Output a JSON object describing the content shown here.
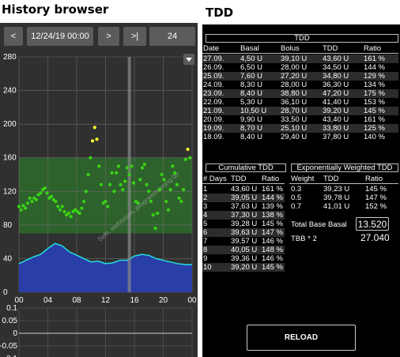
{
  "history": {
    "title": "History browser",
    "prev_label": "<",
    "date_value": "12/24/19 00:00",
    "next_label": ">",
    "end_label": ">|",
    "range_value": "24",
    "menu_icon": "dropdown-triangle-icon",
    "watermark": "Safe, rechtssym, programmierung 0h",
    "colors": {
      "background": "#303030",
      "target_band": "#2e6b2b",
      "bg_in_range": "#39d315",
      "bg_high": "#ffff33",
      "iob_fill": "#2a3ea8",
      "iob_line": "#23e0e0",
      "now_line": "#8a8a8a"
    }
  },
  "chart_data": [
    {
      "type": "scatter",
      "title": "",
      "xlabel": "",
      "ylabel": "",
      "xlim": [
        0,
        24
      ],
      "ylim": [
        0,
        280
      ],
      "x_ticks": [
        "00",
        "04",
        "08",
        "12",
        "16",
        "20",
        "00"
      ],
      "y_ticks": [
        "0",
        "40",
        "80",
        "120",
        "160",
        "200",
        "240",
        "280"
      ],
      "target_range": [
        70,
        160
      ],
      "now_marker_x": 15.3,
      "series": [
        {
          "kind": "points",
          "x": [
            0.0,
            0.3,
            0.6,
            0.9,
            1.2,
            1.5,
            1.8,
            2.1,
            2.4,
            2.7,
            3.0,
            3.3,
            3.6,
            3.9,
            4.2,
            4.5,
            4.8,
            5.1,
            5.4,
            5.7,
            6.0,
            6.3,
            6.6,
            6.9,
            7.2,
            7.5,
            7.8,
            8.1,
            8.4,
            8.7,
            9.0,
            9.3,
            9.6,
            9.9,
            10.2,
            10.5,
            10.8,
            11.1,
            11.4,
            11.7,
            12.0,
            12.3,
            12.6,
            12.9,
            13.2,
            13.5,
            13.8,
            14.1,
            14.4,
            14.7,
            15.0,
            15.3,
            15.6,
            15.9,
            16.2,
            16.5,
            16.8,
            17.1,
            17.4,
            17.7,
            18.0,
            18.3,
            18.6,
            18.9,
            19.2,
            19.5,
            19.8,
            20.1,
            20.4,
            20.7,
            21.0,
            21.3,
            21.6,
            21.9,
            22.2,
            22.5,
            22.8,
            23.1,
            23.4,
            23.7
          ],
          "y": [
            102,
            98,
            103,
            100,
            106,
            112,
            108,
            112,
            110,
            116,
            118,
            122,
            124,
            118,
            112,
            114,
            110,
            108,
            102,
            98,
            102,
            96,
            92,
            94,
            90,
            96,
            98,
            96,
            94,
            100,
            108,
            120,
            140,
            160,
            180,
            196,
            182,
            150,
            128,
            106,
            108,
            102,
            128,
            142,
            120,
            142,
            150,
            128,
            122,
            132,
            148,
            140,
            150,
            130,
            108,
            106,
            134,
            148,
            152,
            128,
            120,
            108,
            92,
            76,
            94,
            122,
            140,
            134,
            108,
            98,
            122,
            150,
            142,
            128,
            112,
            108,
            122,
            158,
            170,
            160
          ]
        },
        {
          "kind": "area",
          "x": [
            0,
            1,
            2,
            3,
            4,
            5,
            6,
            7,
            8,
            9,
            10,
            11,
            12,
            13,
            14,
            15,
            16,
            17,
            18,
            19,
            20,
            21,
            22,
            23,
            24
          ],
          "y": [
            34,
            38,
            42,
            45,
            52,
            58,
            55,
            48,
            44,
            40,
            36,
            37,
            34,
            35,
            38,
            38,
            43,
            45,
            44,
            40,
            38,
            36,
            34,
            33,
            33
          ]
        }
      ]
    },
    {
      "type": "line",
      "title": "",
      "ylim": [
        -0.1,
        0.1
      ],
      "y_ticks": [
        "0.1",
        "0.05",
        "0",
        "-0.05",
        "-0.1"
      ],
      "series": [
        {
          "kind": "flat",
          "y": 0
        }
      ]
    }
  ],
  "tdd": {
    "title": "TDD",
    "section_title": "TDD",
    "headers": [
      "Date",
      "Basal",
      "Bolus",
      "TDD",
      "Ratio"
    ],
    "rows": [
      [
        "27.09.",
        "4,50 U",
        "39,10 U",
        "43,60 U",
        "161 %"
      ],
      [
        "26.09.",
        "6,50 U",
        "28,00 U",
        "34,50 U",
        "144 %"
      ],
      [
        "25.09.",
        "7,60 U",
        "27,20 U",
        "34,80 U",
        "129 %"
      ],
      [
        "24.09.",
        "8,30 U",
        "28,00 U",
        "36,30 U",
        "134 %"
      ],
      [
        "23.09.",
        "8,40 U",
        "38,80 U",
        "47,20 U",
        "175 %"
      ],
      [
        "22.09.",
        "5,30 U",
        "36,10 U",
        "41,40 U",
        "153 %"
      ],
      [
        "21.09.",
        "10,50 U",
        "28,70 U",
        "39,20 U",
        "145 %"
      ],
      [
        "20.09.",
        "9,90 U",
        "33,50 U",
        "43,40 U",
        "161 %"
      ],
      [
        "19.09.",
        "8,70 U",
        "25,10 U",
        "33,80 U",
        "125 %"
      ],
      [
        "18.09.",
        "8,40 U",
        "29,40 U",
        "37,80 U",
        "140 %"
      ]
    ],
    "cumulative": {
      "title": "Cumulative TDD",
      "headers": [
        "# Days",
        "TDD",
        "Ratio"
      ],
      "rows": [
        [
          "1",
          "43,60 U",
          "161 %"
        ],
        [
          "2",
          "39,05 U",
          "144 %"
        ],
        [
          "3",
          "37,63 U",
          "139 %"
        ],
        [
          "4",
          "37,30 U",
          "138 %"
        ],
        [
          "5",
          "39,28 U",
          "145 %"
        ],
        [
          "6",
          "39,63 U",
          "147 %"
        ],
        [
          "7",
          "39,57 U",
          "146 %"
        ],
        [
          "8",
          "40,05 U",
          "148 %"
        ],
        [
          "9",
          "39,36 U",
          "146 %"
        ],
        [
          "10",
          "39,20 U",
          "145 %"
        ]
      ]
    },
    "weighted": {
      "title": "Exponentially Weighted TDD",
      "headers": [
        "Weight",
        "TDD",
        "Ratio"
      ],
      "rows": [
        [
          "0.3",
          "39,23 U",
          "145 %"
        ],
        [
          "0.5",
          "39,78 U",
          "147 %"
        ],
        [
          "0.7",
          "41,01 U",
          "152 %"
        ]
      ]
    },
    "total_base_basal_label": "Total Base Basal",
    "total_base_basal_value": "13.520",
    "tbb2_label": "TBB * 2",
    "tbb2_value": "27.040",
    "reload_label": "RELOAD"
  }
}
